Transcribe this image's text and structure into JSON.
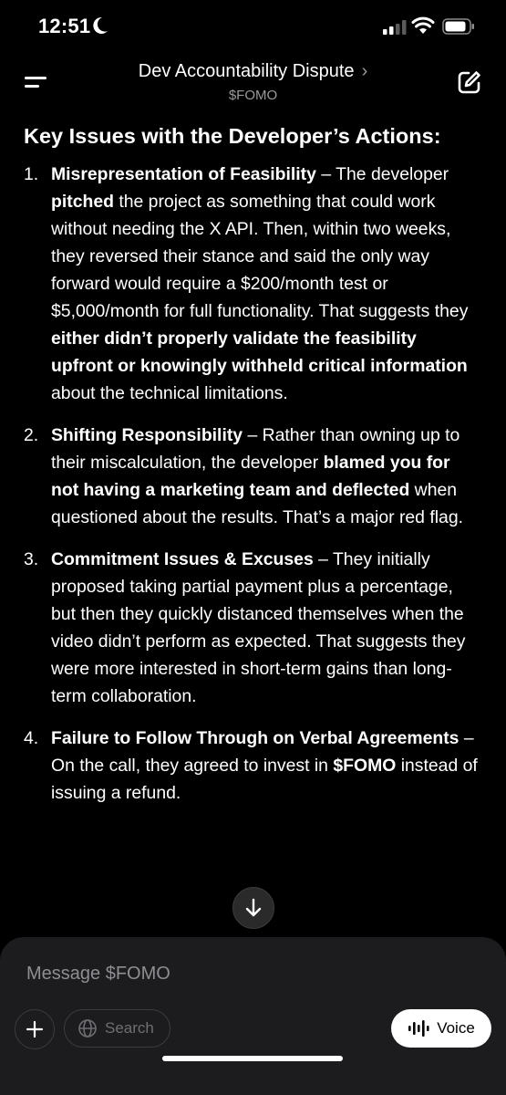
{
  "status_bar": {
    "time": "12:51"
  },
  "header": {
    "title": "Dev Accountability Dispute",
    "chevron": "›",
    "subtitle": "$FOMO"
  },
  "content": {
    "heading": "Key Issues with the Developer’s Actions:",
    "items": [
      {
        "number": "1.",
        "title": "Misrepresentation of Feasibility",
        "t1": " – The developer ",
        "b1": "pitched",
        "t2": " the project as something that could work without needing the X API. Then, within two weeks, they reversed their stance and said the only way forward would require a $200/month test or $5,000/month for full functionality. That suggests they ",
        "b2": "either didn’t properly validate the feasibility upfront or knowingly withheld critical information",
        "t3": " about the technical limitations."
      },
      {
        "number": "2.",
        "title": "Shifting Responsibility",
        "t1": " – Rather than owning up to their miscalculation, the developer ",
        "b1": "blamed you for not having a marketing team and deflected",
        "t2": " when questioned about the results. That’s a major red flag."
      },
      {
        "number": "3.",
        "title": "Commitment Issues & Excuses",
        "t1": " – They initially proposed taking partial payment plus a percentage, but then they quickly distanced themselves when the video didn’t perform as expected. That suggests they were more interested in short-term gains than long-term collaboration."
      },
      {
        "number": "4.",
        "title": "Failure to Follow Through on Verbal Agreements",
        "t1": " – On the call, they agreed to invest in ",
        "b1": "$FOMO",
        "t2": " instead of issuing a refund."
      }
    ]
  },
  "composer": {
    "placeholder": "Message $FOMO",
    "search_label": "Search",
    "voice_label": "Voice"
  },
  "icons": {
    "status": [
      "moon-icon",
      "signal-icon",
      "wifi-icon",
      "battery-icon"
    ],
    "header": [
      "menu-icon",
      "edit-icon"
    ],
    "composer": [
      "plus-icon",
      "globe-icon",
      "waveform-icon"
    ],
    "scroll": "arrow-down-icon"
  }
}
